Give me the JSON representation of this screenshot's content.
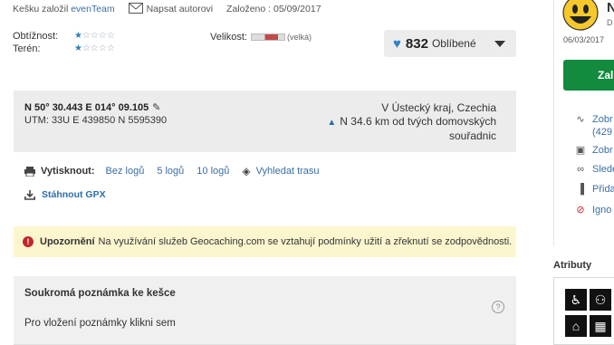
{
  "meta": {
    "hidden_by_label": "Kešku založil",
    "owner": "evenTeam",
    "message_owner": "Napsat autorovi",
    "placed_label": "Založeno : 05/09/2017"
  },
  "ratings": {
    "difficulty_label": "Obtížnost:",
    "terrain_label": "Terén:",
    "difficulty_filled": 1,
    "terrain_filled": 1,
    "max": 5,
    "star_color": "#2f7fb5"
  },
  "size": {
    "label": "Velikost:",
    "value": "(velká)"
  },
  "favorites": {
    "count": "832",
    "label": "Oblíbené",
    "heart_color": "#2e83c9"
  },
  "coordinates": {
    "main": "N 50° 30.443 E 014° 09.105",
    "utm": "UTM: 33U E 439850 N 5595390",
    "region": "V Ústecký kraj, Czechia",
    "distance": "N 34.6 km od tvých domovských souřadnic"
  },
  "print": {
    "label": "Vytisknout:",
    "no_logs": "Bez logů",
    "five_logs": "5 logů",
    "ten_logs": "10 logů",
    "route": "Vyhledat trasu",
    "download_gpx": "Stáhnout GPX"
  },
  "alert": {
    "title": "Upozornění",
    "text": "Na využívání služeb Geocaching.com se vztahují podmínky užití a zřeknutí se zodpovědnosti.",
    "background": "#fcf6cf",
    "icon_color": "#c0262d"
  },
  "personal_note": {
    "title": "Soukromá poznámka ke kešce",
    "hint": "Pro vložení poznámky klikni sem",
    "help": "?"
  },
  "sidebar": {
    "owner_initial": "N",
    "owner_sub": "D",
    "date": "06/03/2017",
    "log_button": "Zal",
    "items": [
      {
        "label": "Zobr",
        "icon": "activity-icon"
      },
      {
        "label": "Zobr",
        "icon": "gallery-icon"
      },
      {
        "label": "Slede",
        "icon": "glasses-icon"
      },
      {
        "label": "Přida",
        "icon": "bookmark-icon"
      },
      {
        "label": "Igno",
        "icon": "block-icon"
      }
    ],
    "item_sub": "(429",
    "attributes_title": "Atributy",
    "green": "#138a3e"
  }
}
